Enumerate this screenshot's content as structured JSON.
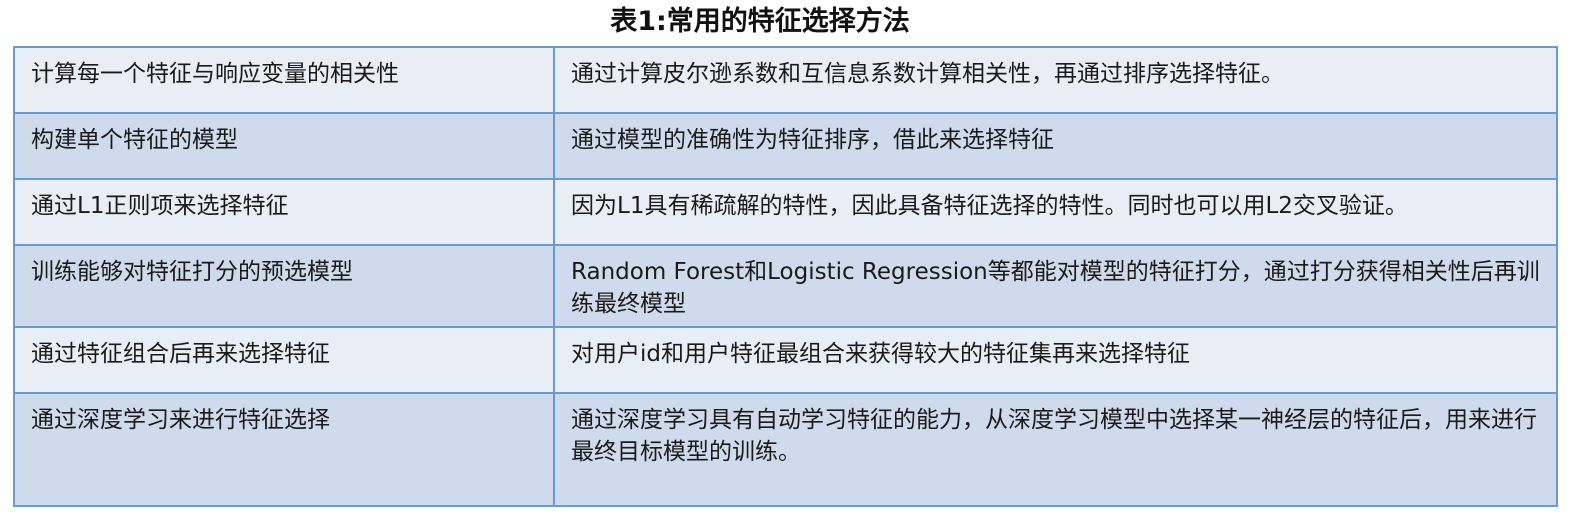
{
  "title": "表1:常用的特征选择方法",
  "rows": [
    {
      "method": "计算每一个特征与响应变量的相关性",
      "description": "通过计算皮尔逊系数和互信息系数计算相关性，再通过排序选择特征。"
    },
    {
      "method": "构建单个特征的模型",
      "description": "通过模型的准确性为特征排序，借此来选择特征"
    },
    {
      "method": "通过L1正则项来选择特征",
      "description": "因为L1具有稀疏解的特性，因此具备特征选择的特性。同时也可以用L2交叉验证。"
    },
    {
      "method": "训练能够对特征打分的预选模型",
      "description": "Random Forest和Logistic Regression等都能对模型的特征打分，通过打分获得相关性后再训练最终模型"
    },
    {
      "method": "通过特征组合后再来选择特征",
      "description": "对用户id和用户特征最组合来获得较大的特征集再来选择特征"
    },
    {
      "method": "通过深度学习来进行特征选择",
      "description": "通过深度学习具有自动学习特征的能力，从深度学习模型中选择某一神经层的特征后，用来进行最终目标模型的训练。"
    }
  ],
  "colors": {
    "border": "#6a9ad2",
    "row_light": "#e9edf6",
    "row_dark": "#cfdbec"
  }
}
